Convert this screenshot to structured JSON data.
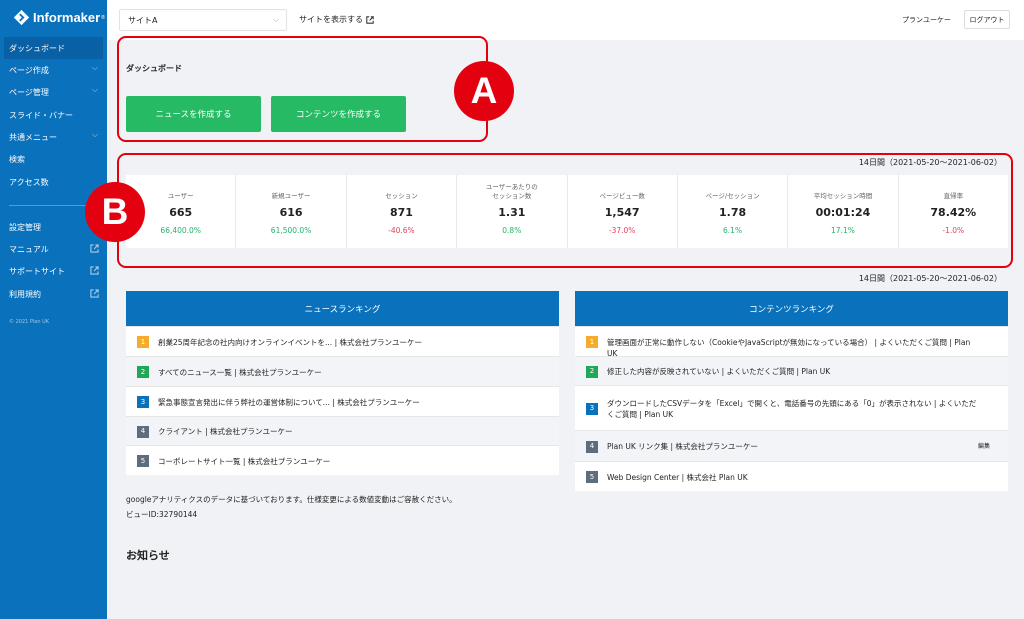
{
  "sidebar": {
    "brand": "Informaker",
    "brand_mark": "®",
    "items": [
      {
        "label": "ダッシュボード",
        "icon": ""
      },
      {
        "label": "ページ作成",
        "icon": "chevron-down-icon"
      },
      {
        "label": "ページ管理",
        "icon": "chevron-down-icon"
      },
      {
        "label": "スライド・バナー",
        "icon": ""
      },
      {
        "label": "共通メニュー",
        "icon": "chevron-down-icon"
      },
      {
        "label": "検索",
        "icon": ""
      },
      {
        "label": "アクセス数",
        "icon": ""
      },
      {
        "label": "設定管理",
        "icon": ""
      },
      {
        "label": "マニュアル",
        "icon": "external-link-icon"
      },
      {
        "label": "サポートサイト",
        "icon": "external-link-icon"
      },
      {
        "label": "利用規約",
        "icon": "external-link-icon"
      }
    ],
    "copyright": "© 2021 Plan UK"
  },
  "header": {
    "site_select_value": "サイトA",
    "view_site_label": "サイトを表示する",
    "company": "プランユーケー",
    "logout_label": "ログアウト"
  },
  "dashboard": {
    "title": "ダッシュボード",
    "create_news_label": "ニュースを作成する",
    "create_content_label": "コンテンツを作成する"
  },
  "annotations": {
    "a": "A",
    "b": "B"
  },
  "period": "14日間（2021-05-20〜2021-06-02）",
  "stats": [
    {
      "label": "ユーザー",
      "value": "665",
      "change": "66,400.0%",
      "trend": "up"
    },
    {
      "label": "新規ユーザー",
      "value": "616",
      "change": "61,500.0%",
      "trend": "up"
    },
    {
      "label": "セッション",
      "value": "871",
      "change": "-40.6%",
      "trend": "down"
    },
    {
      "label": "ユーザーあたりの\nセッション数",
      "value": "1.31",
      "change": "0.8%",
      "trend": "up"
    },
    {
      "label": "ページビュー数",
      "value": "1,547",
      "change": "-37.0%",
      "trend": "down"
    },
    {
      "label": "ページ/セッション",
      "value": "1.78",
      "change": "6.1%",
      "trend": "up"
    },
    {
      "label": "平均セッション時間",
      "value": "00:01:24",
      "change": "17.1%",
      "trend": "up"
    },
    {
      "label": "直帰率",
      "value": "78.42%",
      "change": "-1.0%",
      "trend": "down"
    }
  ],
  "news_ranking": {
    "title": "ニュースランキング",
    "items": [
      {
        "rank": "1",
        "text": "創業25周年記念の社内向けオンラインイベントを... | 株式会社プランユーケー"
      },
      {
        "rank": "2",
        "text": "すべてのニュース一覧 | 株式会社プランユーケー"
      },
      {
        "rank": "3",
        "text": "緊急事態宣言発出に伴う弊社の運営体制について... | 株式会社プランユーケー"
      },
      {
        "rank": "4",
        "text": "クライアント | 株式会社プランユーケー"
      },
      {
        "rank": "5",
        "text": "コーポレートサイト一覧 | 株式会社プランユーケー"
      }
    ]
  },
  "content_ranking": {
    "title": "コンテンツランキング",
    "items": [
      {
        "rank": "1",
        "text": "管理画面が正常に動作しない（CookieやJavaScriptが無効になっている場合） | よくいただくご質問 | Plan UK",
        "edit": ""
      },
      {
        "rank": "2",
        "text": "修正した内容が反映されていない | よくいただくご質問 | Plan UK",
        "edit": ""
      },
      {
        "rank": "3",
        "text": "ダウンロードしたCSVデータを「Excel」で開くと、電話番号の先頭にある「0」が表示されない | よくいただくご質問 | Plan UK",
        "edit": ""
      },
      {
        "rank": "4",
        "text": "Plan UK リンク集 | 株式会社プランユーケー",
        "edit": "編集"
      },
      {
        "rank": "5",
        "text": "Web Design Center | 株式会社 Plan UK",
        "edit": ""
      }
    ]
  },
  "note": {
    "line1": "googleアナリティクスのデータに基づいております。仕様変更による数値変動はご容赦ください。",
    "line2": "ビューID:32790144"
  },
  "notices_title": "お知らせ",
  "colors": {
    "sidebar": "#0a71bd",
    "sidebar_active": "#0960a4",
    "button_green": "#27ba64",
    "up": "#22b36b",
    "down": "#e8425c",
    "annotation_red": "#e3000f",
    "rank": [
      "#f5ac2a",
      "#1fa855",
      "#0a71bd",
      "#5d6d7e",
      "#5d6d7e"
    ]
  }
}
